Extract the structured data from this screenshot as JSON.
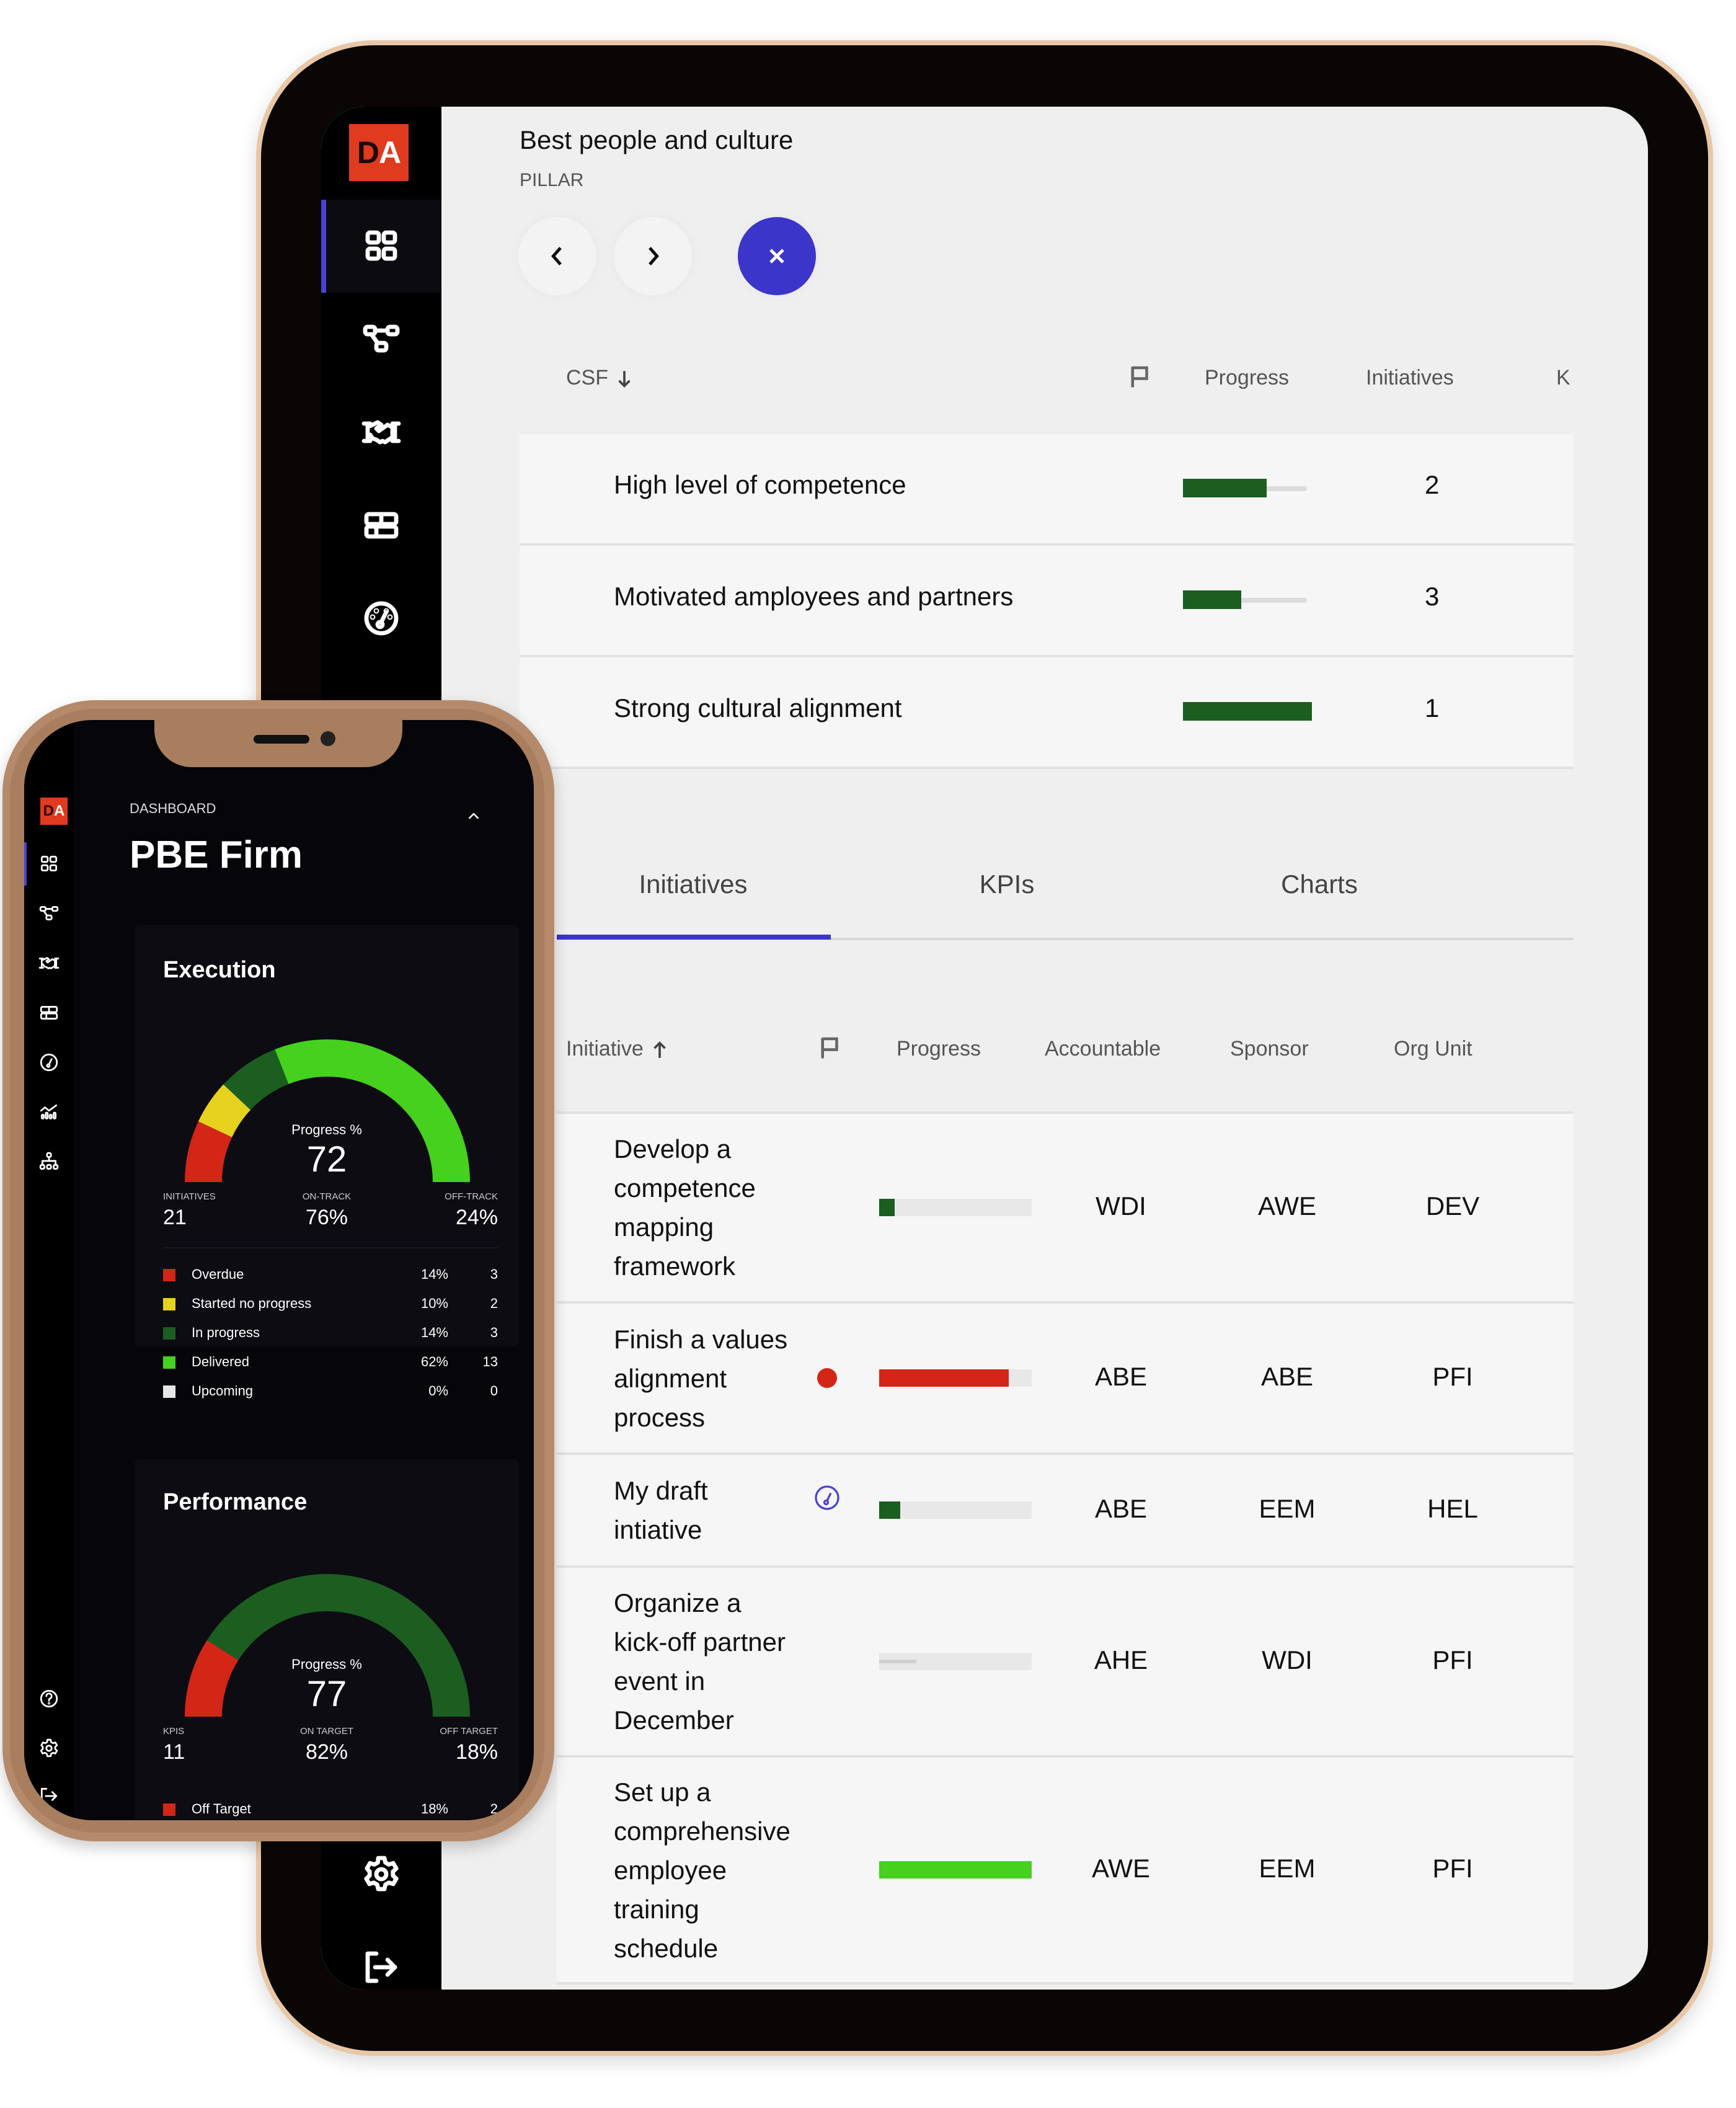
{
  "tablet": {
    "logo": {
      "d": "D",
      "a": "A"
    },
    "sidebar": {
      "items": [
        {
          "name": "dashboard",
          "icon": "grid-icon",
          "active": true
        },
        {
          "name": "strategy-map",
          "icon": "hierarchy-icon",
          "active": false
        },
        {
          "name": "partners",
          "icon": "handshake-icon",
          "active": false
        },
        {
          "name": "layout",
          "icon": "table-layout-icon",
          "active": false
        },
        {
          "name": "performance",
          "icon": "gauge-icon",
          "active": false
        }
      ],
      "bottom_items": [
        {
          "name": "settings",
          "icon": "gear-icon"
        },
        {
          "name": "logout",
          "icon": "logout-icon"
        }
      ]
    },
    "header": {
      "title": "Best people and culture",
      "subtitle": "PILLAR"
    },
    "csf_table": {
      "headers": {
        "csf": "CSF",
        "progress": "Progress",
        "initiatives": "Initiatives",
        "k": "K"
      },
      "sort": "descending",
      "rows": [
        {
          "name": "High level of competence",
          "progress": 0.65,
          "initiatives": "2",
          "color": "#1b5e20"
        },
        {
          "name": "Motivated amployees and partners",
          "progress": 0.45,
          "initiatives": "3",
          "color": "#1b5e20"
        },
        {
          "name": "Strong cultural alignment",
          "progress": 1.0,
          "initiatives": "1",
          "color": "#1b5e20"
        }
      ]
    },
    "tabs": [
      {
        "label": "Initiatives",
        "active": true
      },
      {
        "label": "KPIs",
        "active": false
      },
      {
        "label": "Charts",
        "active": false
      }
    ],
    "initiatives_table": {
      "headers": {
        "initiative": "Initiative",
        "progress": "Progress",
        "accountable": "Accountable",
        "sponsor": "Sponsor",
        "org_unit": "Org Unit"
      },
      "sort": "ascending",
      "rows": [
        {
          "name": "Develop a competence mapping framework",
          "flag": "",
          "progress": 0.1,
          "color": "#1b5e20",
          "accountable": "WDI",
          "sponsor": "AWE",
          "org_unit": "DEV"
        },
        {
          "name": "Finish a values alignment process",
          "flag": "overdue-dot",
          "progress": 0.85,
          "color": "#d32617",
          "accountable": "ABE",
          "sponsor": "ABE",
          "org_unit": "PFI"
        },
        {
          "name": "My draft intiative",
          "flag": "draft-gauge",
          "progress": 0.14,
          "color": "#1b5e20",
          "accountable": "ABE",
          "sponsor": "EEM",
          "org_unit": "HEL"
        },
        {
          "name": "Organize a kick-off partner event in December",
          "flag": "",
          "progress": 0.0,
          "color": "#cccccc",
          "accountable": "AHE",
          "sponsor": "WDI",
          "org_unit": "PFI"
        },
        {
          "name": "Set up a comprehensive employee training schedule",
          "flag": "",
          "progress": 1.0,
          "color": "#45d11e",
          "accountable": "AWE",
          "sponsor": "EEM",
          "org_unit": "PFI"
        }
      ]
    }
  },
  "phone": {
    "logo": {
      "d": "D",
      "a": "A"
    },
    "dashboard_label": "DASHBOARD",
    "title": "PBE Firm",
    "sidebar": {
      "items": [
        "grid-icon",
        "hierarchy-icon",
        "handshake-icon",
        "table-layout-icon",
        "gauge-icon",
        "chart-icon",
        "org-chart-icon"
      ],
      "bottom_items": [
        "help-icon",
        "gear-icon",
        "logout-icon"
      ]
    },
    "execution": {
      "title": "Execution",
      "gauge_label": "Progress %",
      "gauge_value": "72",
      "segments": [
        {
          "name": "Overdue",
          "pct": 14,
          "color": "#d32617"
        },
        {
          "name": "Started no progress",
          "pct": 10,
          "color": "#e6d21e"
        },
        {
          "name": "In progress",
          "pct": 14,
          "color": "#1b5e20"
        },
        {
          "name": "Delivered",
          "pct": 62,
          "color": "#45d11e"
        }
      ],
      "stats": [
        {
          "label": "INITIATIVES",
          "value": "21"
        },
        {
          "label": "ON-TRACK",
          "value": "76%"
        },
        {
          "label": "OFF-TRACK",
          "value": "24%"
        }
      ],
      "legend": [
        {
          "name": "Overdue",
          "pct": "14%",
          "count": "3",
          "color": "#d32617"
        },
        {
          "name": "Started no progress",
          "pct": "10%",
          "count": "2",
          "color": "#e6d21e"
        },
        {
          "name": "In progress",
          "pct": "14%",
          "count": "3",
          "color": "#1b5e20"
        },
        {
          "name": "Delivered",
          "pct": "62%",
          "count": "13",
          "color": "#45d11e"
        },
        {
          "name": "Upcoming",
          "pct": "0%",
          "count": "0",
          "color": "#e6e6e6"
        }
      ]
    },
    "performance": {
      "title": "Performance",
      "gauge_label": "Progress %",
      "gauge_value": "77",
      "segments": [
        {
          "name": "Off Target",
          "pct": 18,
          "color": "#d32617"
        },
        {
          "name": "On Target",
          "pct": 82,
          "color": "#1b5e20"
        }
      ],
      "stats": [
        {
          "label": "KPIS",
          "value": "11"
        },
        {
          "label": "ON TARGET",
          "value": "82%"
        },
        {
          "label": "OFF TARGET",
          "value": "18%"
        }
      ],
      "legend": [
        {
          "name": "Off Target",
          "pct": "18%",
          "count": "2",
          "color": "#d32617"
        }
      ]
    }
  }
}
